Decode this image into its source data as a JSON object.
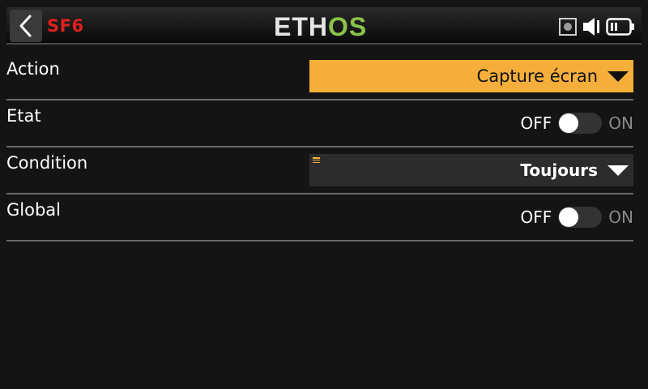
{
  "header": {
    "page_code": "SF6",
    "logo_part1": "ETH",
    "logo_part2": "OS",
    "back_icon": "chevron-left-icon",
    "status_icons": [
      "record-icon",
      "speaker-icon",
      "battery-icon"
    ]
  },
  "rows": [
    {
      "label": "Action",
      "type": "select",
      "value": "Capture écran"
    },
    {
      "label": "Etat",
      "type": "toggle",
      "off_label": "OFF",
      "on_label": "ON",
      "state": "off"
    },
    {
      "label": "Condition",
      "type": "select",
      "value": "Toujours"
    },
    {
      "label": "Global",
      "type": "toggle",
      "off_label": "OFF",
      "on_label": "ON",
      "state": "off"
    }
  ],
  "colors": {
    "accent": "#f6ae3b",
    "code_red": "#e0201e",
    "logo_green": "#8bc34a",
    "background": "#141414"
  }
}
